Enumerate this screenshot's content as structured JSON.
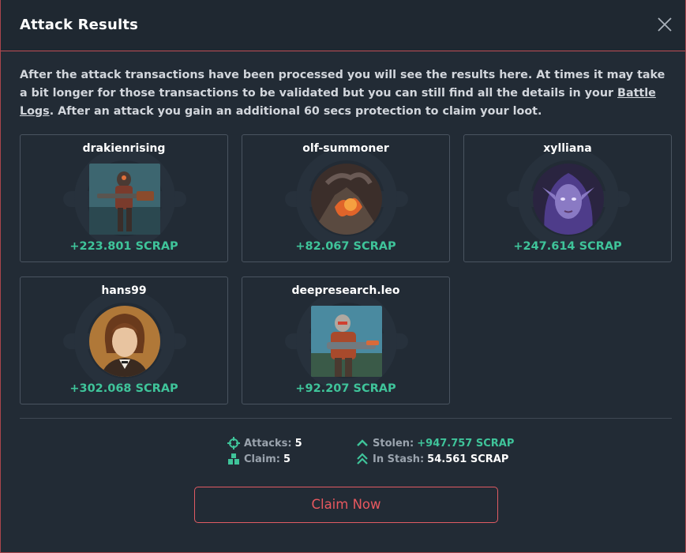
{
  "header": {
    "title": "Attack Results"
  },
  "description": {
    "before_link": "After the attack transactions have been processed you will see the results here. At times it may take a bit longer for those transactions to be validated but you can still find all the details in your ",
    "link": "Battle Logs",
    "after_link": ". After an attack you gain an additional 60 secs protection to claim your loot."
  },
  "results": [
    {
      "name": "drakienrising",
      "amount": "+223.801 SCRAP",
      "avatar_icon": "armored-gunner-avatar"
    },
    {
      "name": "olf-summoner",
      "amount": "+82.067 SCRAP",
      "avatar_icon": "volcano-avatar"
    },
    {
      "name": "xylliana",
      "amount": "+247.614 SCRAP",
      "avatar_icon": "purple-elf-avatar"
    },
    {
      "name": "hans99",
      "amount": "+302.068 SCRAP",
      "avatar_icon": "portrait-avatar"
    },
    {
      "name": "deepresearch.leo",
      "amount": "+92.207 SCRAP",
      "avatar_icon": "soldier-avatar"
    }
  ],
  "summary": {
    "attacks_label": "Attacks:",
    "attacks_value": "5",
    "claim_label": "Claim:",
    "claim_value": "5",
    "stolen_label": "Stolen:",
    "stolen_value": "+947.757 SCRAP",
    "stash_label": "In Stash:",
    "stash_value": "54.561 SCRAP"
  },
  "claim_button": "Claim Now",
  "colors": {
    "accent_red": "#e05b63",
    "scrap_green": "#3fc49a",
    "panel": "#222b35"
  }
}
